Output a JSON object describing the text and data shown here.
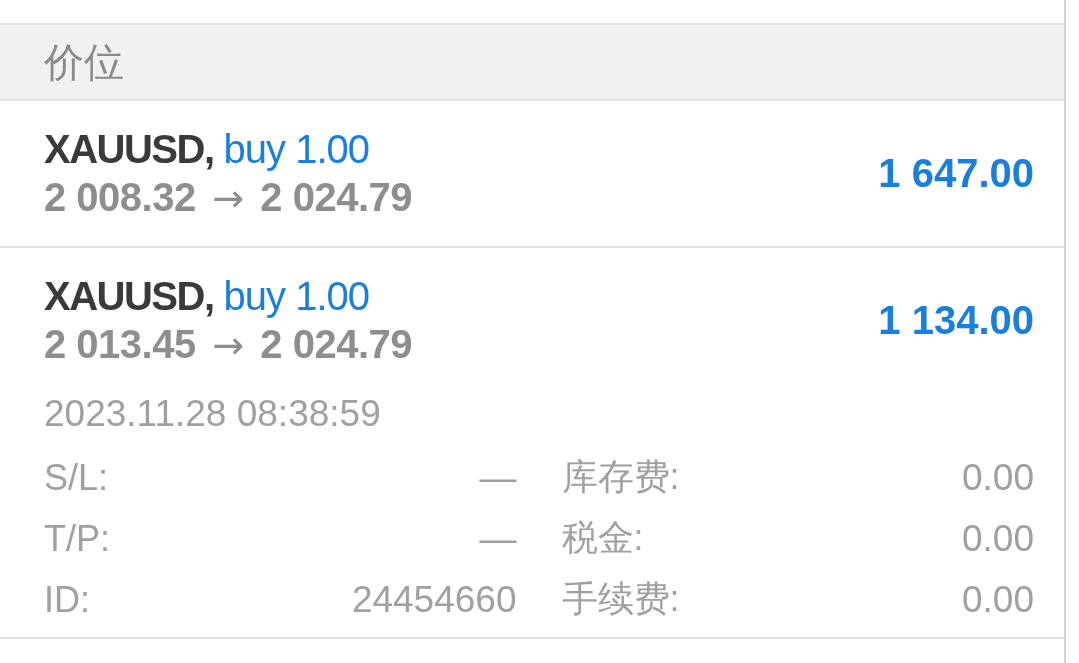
{
  "section_header": {
    "title": "价位"
  },
  "positions": [
    {
      "symbol": "XAUUSD,",
      "order": "buy 1.00",
      "open_price": "2 008.32",
      "arrow": "→",
      "current_price": "2 024.79",
      "profit": "1 647.00"
    },
    {
      "symbol": "XAUUSD,",
      "order": "buy 1.00",
      "open_price": "2 013.45",
      "arrow": "→",
      "current_price": "2 024.79",
      "profit": "1 134.00",
      "time": "2023.11.28 08:38:59",
      "details": [
        {
          "label": "S/L:",
          "value": "—"
        },
        {
          "label": "库存费:",
          "value": "0.00"
        },
        {
          "label": "T/P:",
          "value": "—"
        },
        {
          "label": "税金:",
          "value": "0.00"
        },
        {
          "label": "ID:",
          "value": "24454660"
        },
        {
          "label": "手续费:",
          "value": "0.00"
        }
      ]
    }
  ]
}
